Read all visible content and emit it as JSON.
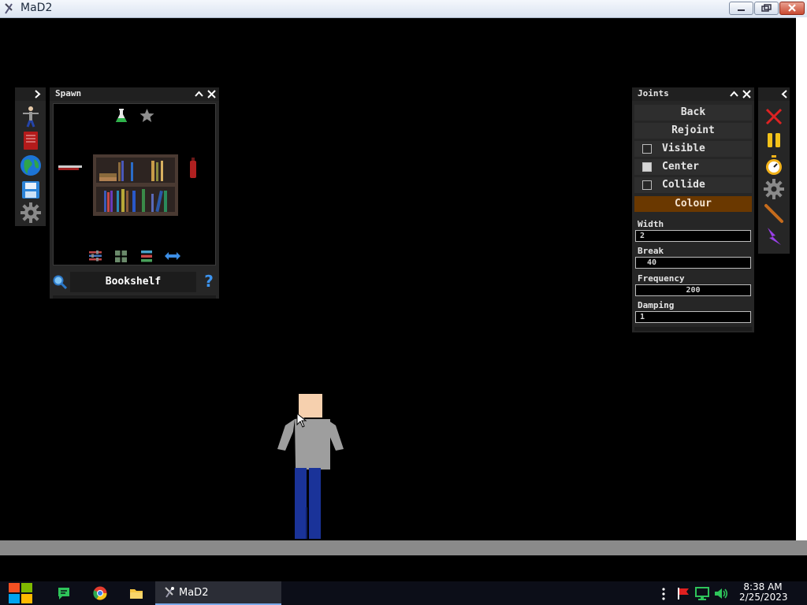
{
  "window": {
    "title": "MaD2"
  },
  "spawn_panel": {
    "title": "Spawn",
    "selected_item": "Bookshelf",
    "help_glyph": "?"
  },
  "joints_panel": {
    "title": "Joints",
    "buttons": {
      "back": "Back",
      "rejoint": "Rejoint",
      "colour": "Colour"
    },
    "checkboxes": [
      {
        "label": "Visible",
        "checked": false
      },
      {
        "label": "Center",
        "checked": true
      },
      {
        "label": "Collide",
        "checked": false
      }
    ],
    "fields": [
      {
        "label": "Width",
        "value": "2"
      },
      {
        "label": "Break",
        "value": "40"
      },
      {
        "label": "Frequency",
        "value": "200"
      },
      {
        "label": "Damping",
        "value": "1"
      }
    ]
  },
  "taskbar": {
    "active_app": "MaD2",
    "time": "8:38 AM",
    "date": "2/25/2023"
  },
  "colors": {
    "panel_bg": "#262626",
    "colour_button": "#6a3800",
    "ground": "#8a8a8a",
    "shirt": "#9e9e9e",
    "pants": "#1a3399",
    "skin": "#f6d0ae"
  }
}
